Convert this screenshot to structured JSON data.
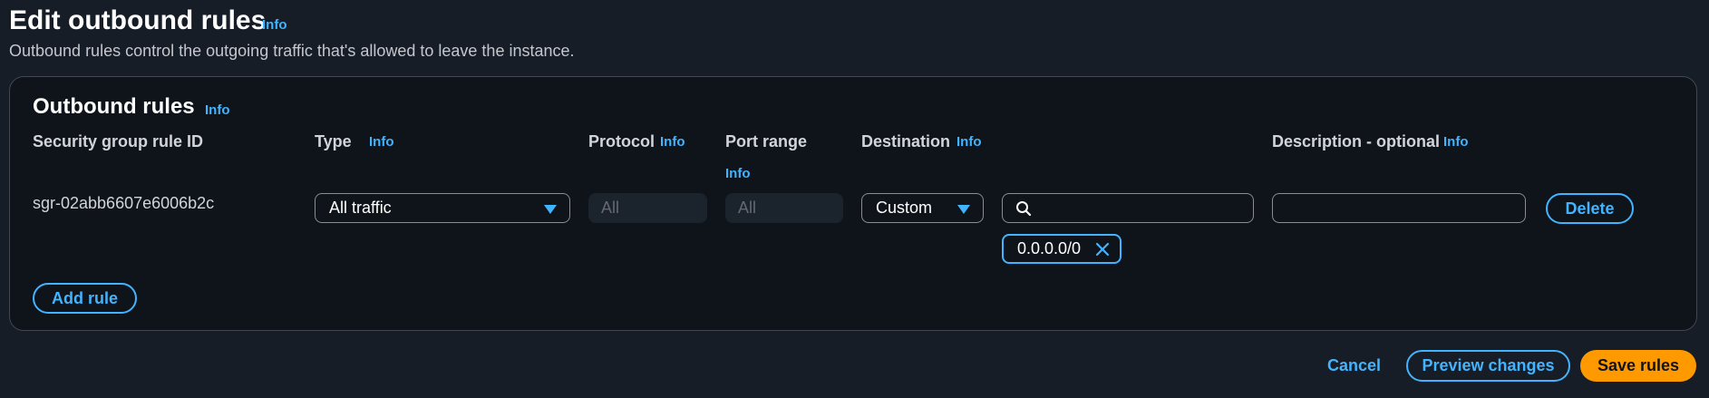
{
  "page": {
    "title": "Edit outbound rules",
    "title_info": "Info",
    "description": "Outbound rules control the outgoing traffic that's allowed to leave the instance."
  },
  "panel": {
    "title": "Outbound rules",
    "title_info": "Info",
    "columns": {
      "rule_id": "Security group rule ID",
      "type": "Type",
      "type_info": "Info",
      "protocol": "Protocol",
      "protocol_info": "Info",
      "port_range": "Port range",
      "port_range_info": "Info",
      "destination": "Destination",
      "destination_info": "Info",
      "description": "Description - optional",
      "description_info": "Info"
    },
    "rule": {
      "id": "sgr-02abb6607e6006b2c",
      "type": "All traffic",
      "protocol_placeholder": "All",
      "port_range_placeholder": "All",
      "destination_type": "Custom",
      "destination_search_value": "",
      "destination_token": "0.0.0.0/0",
      "description_value": "",
      "delete_label": "Delete"
    },
    "add_rule_label": "Add rule"
  },
  "footer": {
    "cancel_label": "Cancel",
    "preview_label": "Preview changes",
    "save_label": "Save rules"
  },
  "colors": {
    "background": "#161d26",
    "panel": "#0f141a",
    "accent": "#42b4ff",
    "primary": "#ff9900"
  },
  "icons": {
    "search": "search-icon",
    "dismiss": "close-icon",
    "dropdown": "caret-down-icon"
  }
}
